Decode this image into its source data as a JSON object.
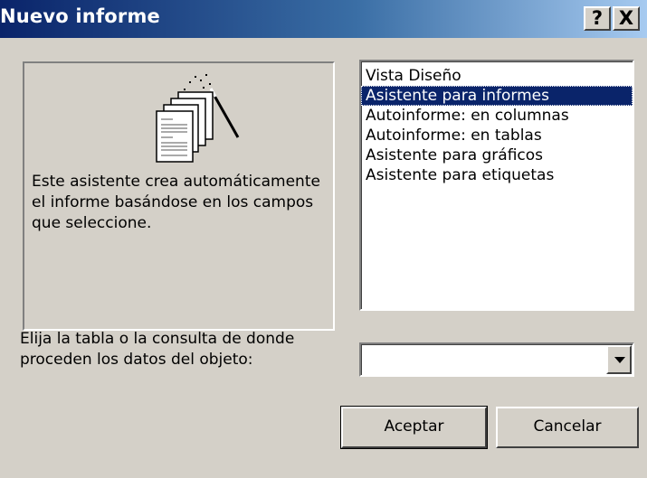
{
  "window": {
    "title": "Nuevo informe",
    "help_label": "?",
    "close_label": "X"
  },
  "preview": {
    "icon": "report-wizard-icon",
    "description": "Este asistente crea automáticamente el informe basándose en los campos que seleccione."
  },
  "list": {
    "items": [
      {
        "label": "Vista Diseño",
        "selected": false
      },
      {
        "label": "Asistente para informes",
        "selected": true
      },
      {
        "label": "Autoinforme: en columnas",
        "selected": false
      },
      {
        "label": "Autoinforme: en tablas",
        "selected": false
      },
      {
        "label": "Asistente para gráficos",
        "selected": false
      },
      {
        "label": "Asistente para etiquetas",
        "selected": false
      }
    ]
  },
  "source": {
    "prompt": "Elija la tabla o la consulta de donde proceden los datos del objeto:",
    "value": ""
  },
  "buttons": {
    "ok_label": "Aceptar",
    "cancel_label": "Cancelar"
  },
  "colors": {
    "title_bar_start": "#0a246a",
    "title_bar_end": "#a6caf0",
    "selection": "#0a246a",
    "face": "#d4d0c8"
  }
}
